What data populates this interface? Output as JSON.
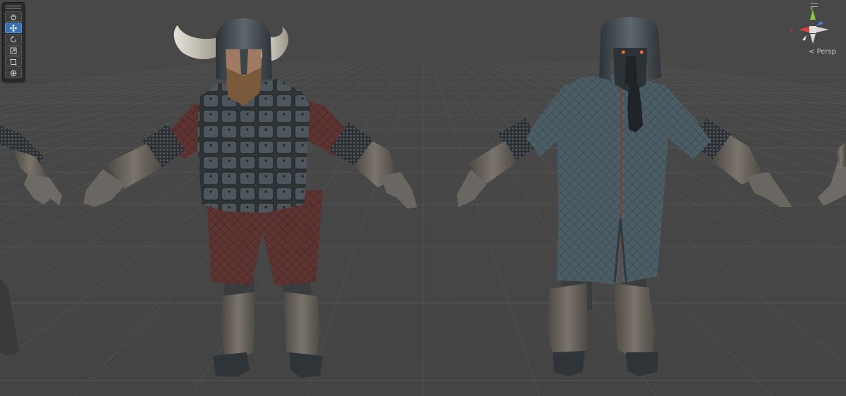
{
  "scene_view": {
    "background_color": "#474747",
    "grid_color": "#5a5a5a",
    "projection_label": "Persp",
    "gizmo_axes": {
      "x": "x",
      "y": "y"
    },
    "gizmo_colors": {
      "x": "#d9413a",
      "y": "#8cc63e",
      "z": "#4a7fd8",
      "neutral": "#d8d8d8"
    }
  },
  "toolbar": {
    "tools": [
      {
        "name": "hand-tool",
        "icon": "hand-icon",
        "active": false
      },
      {
        "name": "move-tool",
        "icon": "move-icon",
        "active": true
      },
      {
        "name": "rotate-tool",
        "icon": "rotate-icon",
        "active": false
      },
      {
        "name": "scale-tool",
        "icon": "scale-icon",
        "active": false
      },
      {
        "name": "rect-tool",
        "icon": "rect-icon",
        "active": false
      },
      {
        "name": "transform-tool",
        "icon": "transform-icon",
        "active": false
      }
    ]
  },
  "models": [
    {
      "name": "horned-warrior",
      "armor_color": "#4a5258",
      "tunic_color": "#5e3432",
      "skin_tone": "#a07a62"
    },
    {
      "name": "gambeson-warrior",
      "armor_color": "#3c454b",
      "tunic_color": "#4c5d66",
      "eye_color": "#e87030"
    }
  ]
}
